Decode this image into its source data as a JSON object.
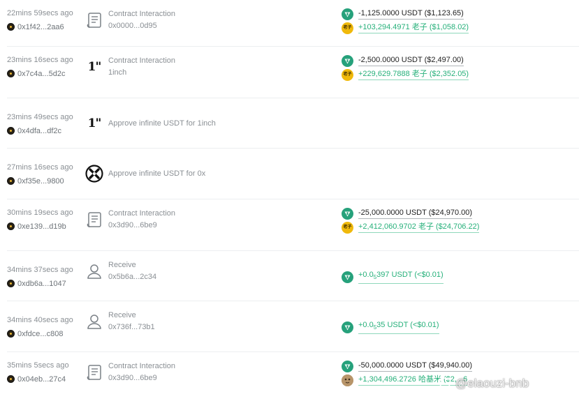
{
  "transactions": [
    {
      "time": "22mins 59secs ago",
      "address": "0x1f42...2aa6",
      "type_icon": "contract-scroll-icon",
      "title": "Contract Interaction",
      "subtitle": "0x0000...0d95",
      "changes": [
        {
          "token": "USDT",
          "icon": "usdt-icon",
          "sign": "neg",
          "text": "-1,125.0000 USDT ($1,123.65)"
        },
        {
          "token": "老子",
          "icon": "laozi-token-icon",
          "sign": "pos",
          "text": "+103,294.4971 老子 ($1,058.02)"
        }
      ]
    },
    {
      "time": "23mins 16secs ago",
      "address": "0x7c4a...5d2c",
      "type_icon": "oneinch-logo-icon",
      "type_glyph": "1\"",
      "title": "Contract Interaction",
      "subtitle": "1inch",
      "changes": [
        {
          "token": "USDT",
          "icon": "usdt-icon",
          "sign": "neg",
          "text": "-2,500.0000 USDT ($2,497.00)"
        },
        {
          "token": "老子",
          "icon": "laozi-token-icon",
          "sign": "pos",
          "text": "+229,629.7888 老子 ($2,352.05)"
        }
      ]
    },
    {
      "time": "23mins 49secs ago",
      "address": "0x4dfa...df2c",
      "type_icon": "oneinch-logo-icon",
      "type_glyph": "1\"",
      "title": "Approve infinite USDT for 1inch",
      "subtitle": "",
      "changes": []
    },
    {
      "time": "27mins 16secs ago",
      "address": "0xf35e...9800",
      "type_icon": "zerox-logo-icon",
      "title": "Approve infinite USDT for 0x",
      "subtitle": "",
      "changes": []
    },
    {
      "time": "30mins 19secs ago",
      "address": "0xe139...d19b",
      "type_icon": "contract-scroll-icon",
      "title": "Contract Interaction",
      "subtitle": "0x3d90...6be9",
      "changes": [
        {
          "token": "USDT",
          "icon": "usdt-icon",
          "sign": "neg",
          "text": "-25,000.0000 USDT ($24,970.00)"
        },
        {
          "token": "老子",
          "icon": "laozi-token-icon",
          "sign": "pos",
          "text": "+2,412,060.9702 老子 ($24,706.22)"
        }
      ]
    },
    {
      "time": "34mins 37secs ago",
      "address": "0xdb6a...1047",
      "type_icon": "person-icon",
      "title": "Receive",
      "subtitle": "0x5b6a...2c34",
      "changes": [
        {
          "token": "USDT",
          "icon": "usdt-icon",
          "sign": "pos",
          "pre": "+0.0",
          "zeros": "5",
          "digits": "397",
          "text": " USDT (<$0.01)"
        }
      ]
    },
    {
      "time": "34mins 40secs ago",
      "address": "0xfdce...c808",
      "type_icon": "person-icon",
      "title": "Receive",
      "subtitle": "0x736f...73b1",
      "changes": [
        {
          "token": "USDT",
          "icon": "usdt-icon",
          "sign": "pos",
          "pre": "+0.0",
          "zeros": "5",
          "digits": "35",
          "text": " USDT (<$0.01)"
        }
      ]
    },
    {
      "time": "35mins 5secs ago",
      "address": "0x04eb...27c4",
      "type_icon": "contract-scroll-icon",
      "title": "Contract Interaction",
      "subtitle": "0x3d90...6be9",
      "changes": [
        {
          "token": "USDT",
          "icon": "usdt-icon",
          "sign": "neg",
          "text": "-50,000.0000 USDT ($49,940.00)"
        },
        {
          "token": "哈基米",
          "icon": "hajimi-token-icon",
          "sign": "pos",
          "text": "+1,304,496.2726 哈基米 ($2,...6"
        }
      ]
    }
  ],
  "watermark": "@elaouzi-bnb",
  "colors": {
    "positive": "#26b07a",
    "negative": "#222222",
    "usdt": "#26a17b",
    "laozi": "#f0b90b",
    "muted": "#8a8f94"
  }
}
